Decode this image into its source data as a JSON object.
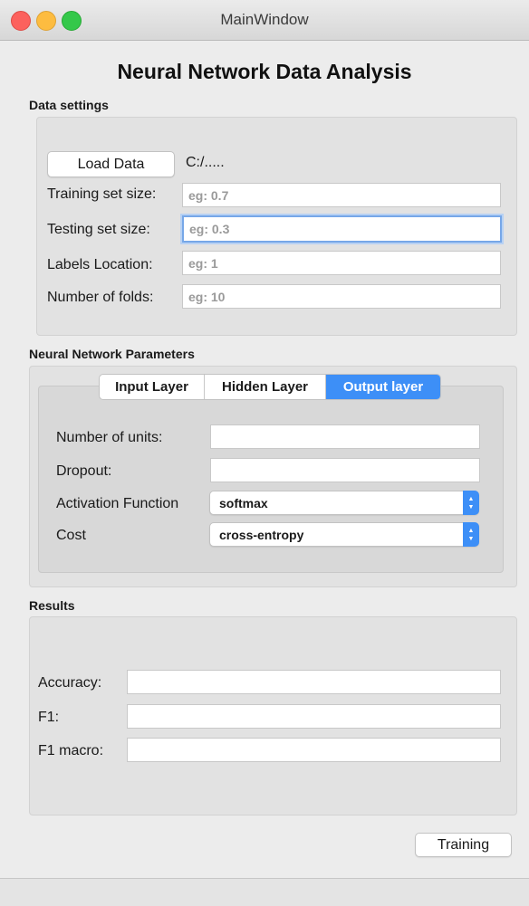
{
  "window": {
    "title": "MainWindow"
  },
  "app_title": "Neural Network Data Analysis",
  "data_settings": {
    "section_label": "Data settings",
    "load_button_label": "Load Data",
    "path_text": "C:/.....",
    "training_label": "Training set size:",
    "training_placeholder": "eg: 0.7",
    "testing_label": "Testing set size:",
    "testing_placeholder": "eg: 0.3",
    "labels_label": "Labels Location:",
    "labels_placeholder": "eg: 1",
    "folds_label": "Number of folds:",
    "folds_placeholder": "eg: 10"
  },
  "nn_params": {
    "section_label": "Neural Network Parameters",
    "tabs": [
      {
        "label": "Input Layer",
        "active": false
      },
      {
        "label": "Hidden Layer",
        "active": false
      },
      {
        "label": "Output layer",
        "active": true
      }
    ],
    "units_label": "Number of units:",
    "units_value": "",
    "dropout_label": "Dropout:",
    "dropout_value": "",
    "activation_label": "Activation Function",
    "activation_value": "softmax",
    "cost_label": "Cost",
    "cost_value": "cross-entropy"
  },
  "results": {
    "section_label": "Results",
    "accuracy_label": "Accuracy:",
    "accuracy_value": "",
    "f1_label": "F1:",
    "f1_value": "",
    "f1_macro_label": "F1 macro:",
    "f1_macro_value": ""
  },
  "training_button_label": "Training",
  "colors": {
    "accent": "#3d8ff7",
    "focus_ring": "#76a7e8",
    "close": "#fc615d",
    "minimize": "#fdbc40",
    "zoom": "#34c84a"
  },
  "icons": {
    "combo_arrow": "chevron-up-down-icon"
  }
}
